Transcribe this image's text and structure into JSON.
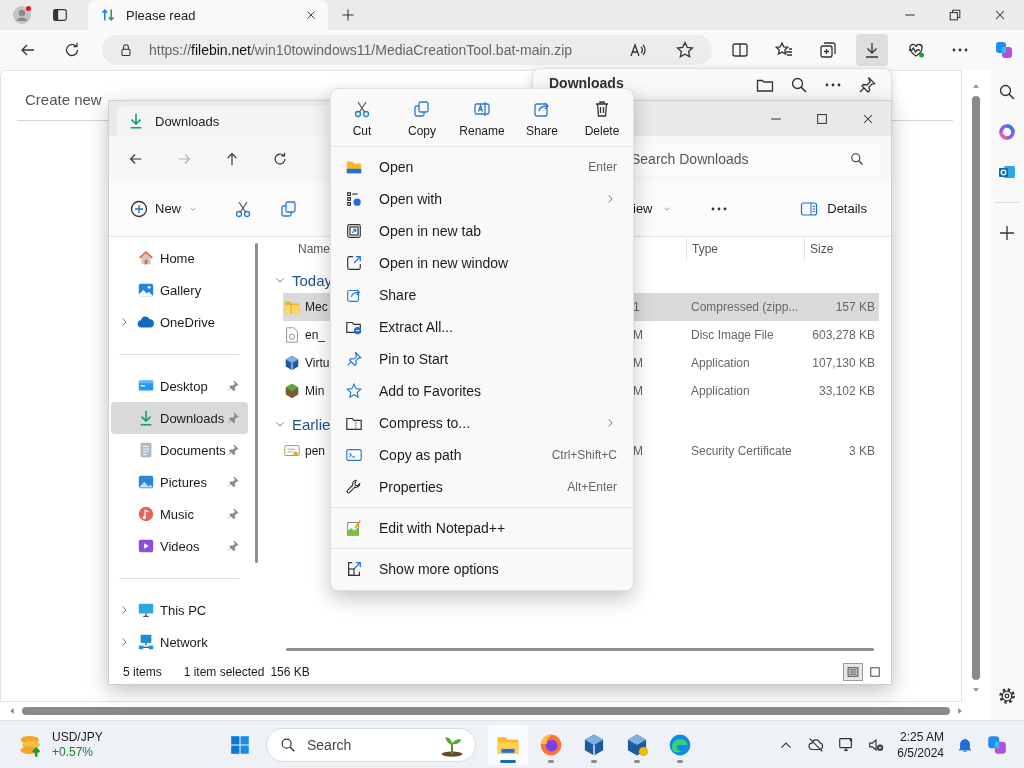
{
  "browser": {
    "tabs": [
      {
        "title": "Please read",
        "selected": true
      }
    ],
    "address": {
      "scheme": "https://",
      "domain": "filebin.net",
      "path": "/win10towindows11/MediaCreationTool.bat-main.zip"
    },
    "toolbar": [
      {
        "selected": false
      },
      {
        "selected": false
      },
      {
        "selected": false
      },
      {
        "selected": true
      },
      {
        "selected": false
      },
      {
        "selected": false
      },
      {
        "selected": false
      }
    ]
  },
  "page": {
    "heading": "Create new"
  },
  "downloads_flyout": {
    "title": "Downloads"
  },
  "explorer": {
    "title": "Downloads",
    "nav_buttons": [
      {
        "disabled": false
      },
      {
        "disabled": true
      },
      {
        "disabled": false
      },
      {
        "disabled": false
      }
    ],
    "search": {
      "placeholder": "Search Downloads"
    },
    "toolbar": {
      "new": "New",
      "view": "iew",
      "details": "Details"
    },
    "columns": [
      "Name",
      "Type",
      "Size"
    ],
    "sidebar": [
      [
        {
          "label": "Home",
          "expandable": false,
          "pinned": false,
          "selected": false
        },
        {
          "label": "Gallery",
          "expandable": false,
          "pinned": false,
          "selected": false
        },
        {
          "label": "OneDrive",
          "expandable": true,
          "pinned": false,
          "selected": false
        }
      ],
      [
        {
          "label": "Desktop",
          "expandable": false,
          "pinned": true,
          "selected": false
        },
        {
          "label": "Downloads",
          "expandable": false,
          "pinned": true,
          "selected": true
        },
        {
          "label": "Documents",
          "expandable": false,
          "pinned": true,
          "selected": false
        },
        {
          "label": "Pictures",
          "expandable": false,
          "pinned": true,
          "selected": false
        },
        {
          "label": "Music",
          "expandable": false,
          "pinned": true,
          "selected": false
        },
        {
          "label": "Videos",
          "expandable": false,
          "pinned": true,
          "selected": false
        }
      ],
      [
        {
          "label": "This PC",
          "expandable": true,
          "pinned": false,
          "selected": false
        },
        {
          "label": "Network",
          "expandable": true,
          "pinned": false,
          "selected": false
        }
      ]
    ],
    "groups": [
      {
        "label": "Today",
        "expanded": true,
        "files": [
          {
            "name": "Mec",
            "date": "1",
            "type": "Compressed (zipp...",
            "size": "157 KB",
            "selected": true
          },
          {
            "name": "en_",
            "date": "M",
            "type": "Disc Image File",
            "size": "603,278 KB",
            "selected": false
          },
          {
            "name": "Virtu",
            "date": "M",
            "type": "Application",
            "size": "107,130 KB",
            "selected": false
          },
          {
            "name": "Min",
            "date": "M",
            "type": "Application",
            "size": "33,102 KB",
            "selected": false
          }
        ]
      },
      {
        "label": "Earlie",
        "expanded": true,
        "files": [
          {
            "name": "pen",
            "date": "M",
            "type": "Security Certificate",
            "size": "3 KB",
            "selected": false
          }
        ]
      }
    ],
    "status": {
      "count": "5 items",
      "selection": "1 item selected",
      "size": "156 KB"
    },
    "views": [
      {
        "selected": true
      },
      {
        "selected": false
      }
    ]
  },
  "context_menu": {
    "actions": [
      "Cut",
      "Copy",
      "Rename",
      "Share",
      "Delete"
    ],
    "sections": [
      [
        {
          "label": "Open",
          "shortcut": "Enter",
          "submenu": false
        },
        {
          "label": "Open with",
          "submenu": true
        },
        {
          "label": "Open in new tab",
          "submenu": false
        },
        {
          "label": "Open in new window",
          "submenu": false
        },
        {
          "label": "Share",
          "submenu": false
        },
        {
          "label": "Extract All...",
          "submenu": false
        },
        {
          "label": "Pin to Start",
          "submenu": false
        },
        {
          "label": "Add to Favorites",
          "submenu": false
        },
        {
          "label": "Compress to...",
          "submenu": true
        },
        {
          "label": "Copy as path",
          "shortcut": "Ctrl+Shift+C",
          "submenu": false
        },
        {
          "label": "Properties",
          "shortcut": "Alt+Enter",
          "submenu": false
        }
      ],
      [
        {
          "label": "Edit with Notepad++",
          "submenu": false
        }
      ],
      [
        {
          "label": "Show more options",
          "submenu": false
        }
      ]
    ]
  },
  "taskbar": {
    "widget": {
      "label": "USD/JPY",
      "change": "+0.57%"
    },
    "search": {
      "placeholder": "Search"
    },
    "apps": [
      {
        "active": true
      },
      {
        "active": false
      },
      {
        "active": false
      },
      {
        "active": false
      },
      {
        "active": false
      }
    ],
    "time": "2:25 AM",
    "date": "6/5/2024"
  }
}
